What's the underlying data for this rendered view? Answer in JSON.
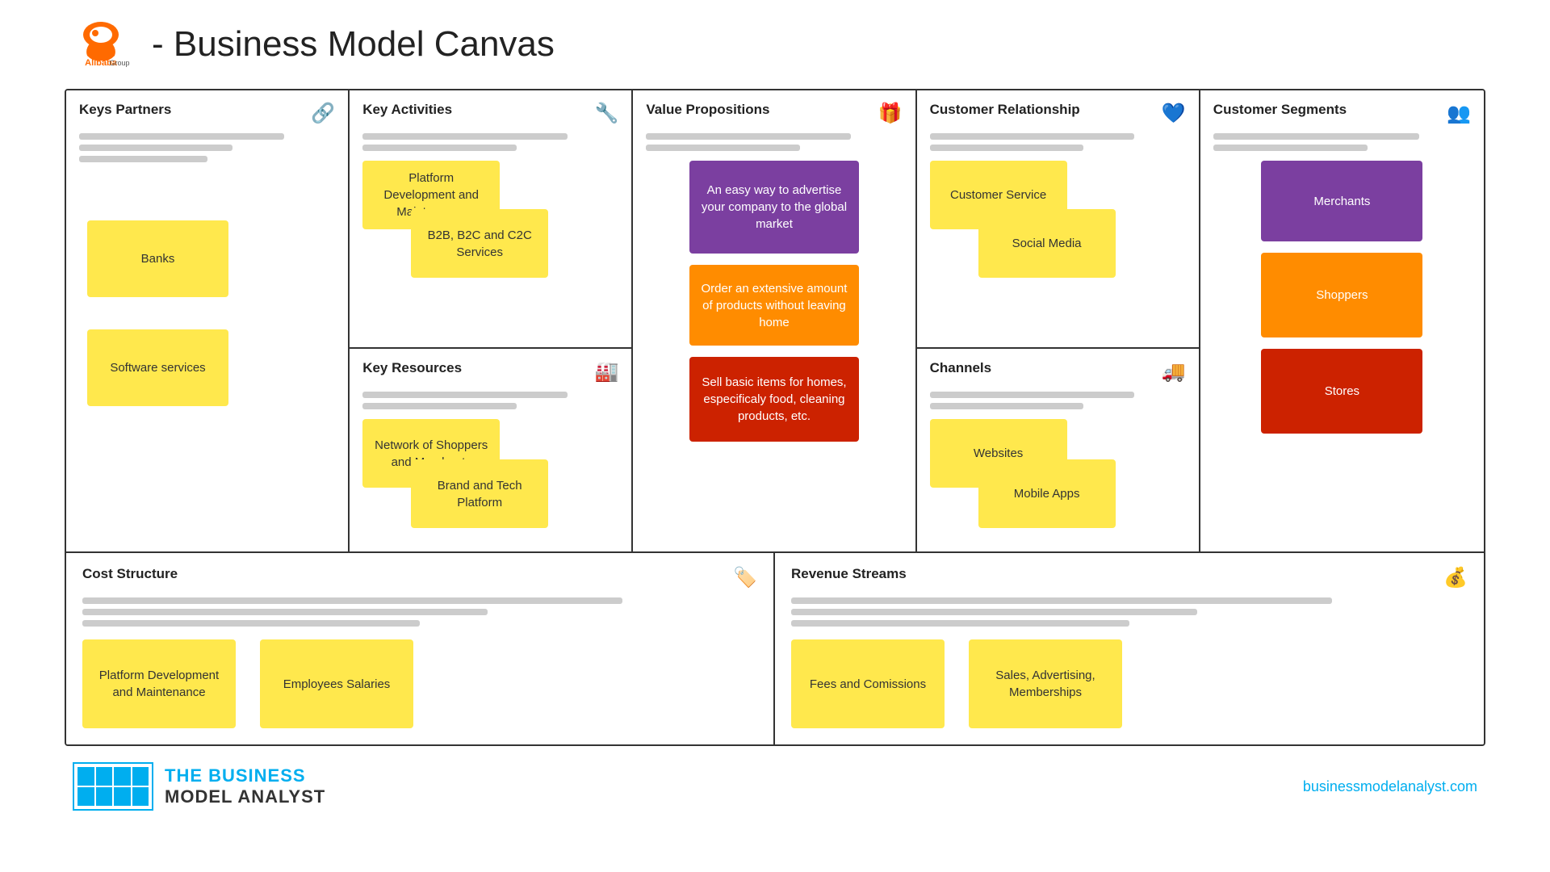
{
  "header": {
    "title": "- Business Model Canvas",
    "logo_alibaba": "Alibaba",
    "logo_group": " Group"
  },
  "sections": {
    "keys_partners": {
      "title": "Keys Partners",
      "banks": "Banks",
      "software_services": "Software services"
    },
    "key_activities": {
      "title": "Key Activities",
      "platform_dev": "Platform Development and Maintenance",
      "b2b": "B2B, B2C and C2C Services"
    },
    "key_resources": {
      "title": "Key Resources",
      "network": "Network of Shoppers and Merchants",
      "brand": "Brand and Tech Platform"
    },
    "value_propositions": {
      "title": "Value Propositions",
      "vp1": "An easy way to advertise your company to the global market",
      "vp2": "Order an extensive amount of products without leaving home",
      "vp3": "Sell basic items for homes, especificaly food, cleaning products, etc."
    },
    "customer_relationship": {
      "title": "Customer Relationship",
      "service": "Customer Service",
      "social": "Social Media"
    },
    "channels": {
      "title": "Channels",
      "websites": "Websites",
      "mobile": "Mobile Apps"
    },
    "customer_segments": {
      "title": "Customer Segments",
      "merchants": "Merchants",
      "shoppers": "Shoppers",
      "stores": "Stores"
    },
    "cost_structure": {
      "title": "Cost Structure",
      "platform": "Platform Development and Maintenance",
      "employees": "Employees Salaries"
    },
    "revenue_streams": {
      "title": "Revenue Streams",
      "fees": "Fees and Comissions",
      "sales": "Sales, Advertising, Memberships"
    }
  },
  "footer": {
    "brand_line1": "THE BUSINESS",
    "brand_line2": "MODEL ANALYST",
    "url": "businessmodelanalyst.com"
  },
  "icons": {
    "keys_partners": "🔗",
    "key_activities": "🔧",
    "value_propositions": "🎁",
    "customer_relationship": "💙",
    "customer_segments": "👥",
    "key_resources": "🏭",
    "channels": "🚚",
    "cost_structure": "🏷️",
    "revenue_streams": "💰"
  }
}
